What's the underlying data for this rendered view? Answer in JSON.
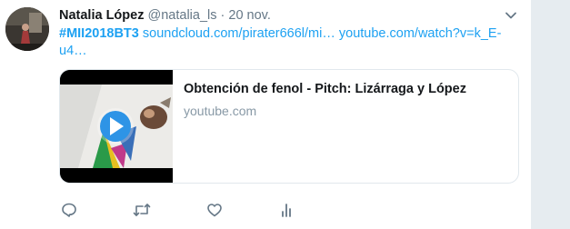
{
  "tweet": {
    "name": "Natalia López",
    "handle": "@natalia_ls",
    "separator": "·",
    "date": "20 nov.",
    "hashtag": "#MII2018BT3",
    "link1": "soundcloud.com/pirater666l/mi…",
    "link2": "youtube.com/watch?v=k_E-u4…"
  },
  "card": {
    "title": "Obtención de fenol - Pitch: Lizárraga y López",
    "domain": "youtube.com"
  },
  "icons": {
    "reply": "reply-icon",
    "retweet": "retweet-icon",
    "like": "heart-icon",
    "analytics": "analytics-icon",
    "more": "chevron-down-icon"
  },
  "colors": {
    "link": "#1da1f2",
    "secondary": "#657786",
    "border": "#e1e8ed",
    "background": "#e6ecf0"
  }
}
